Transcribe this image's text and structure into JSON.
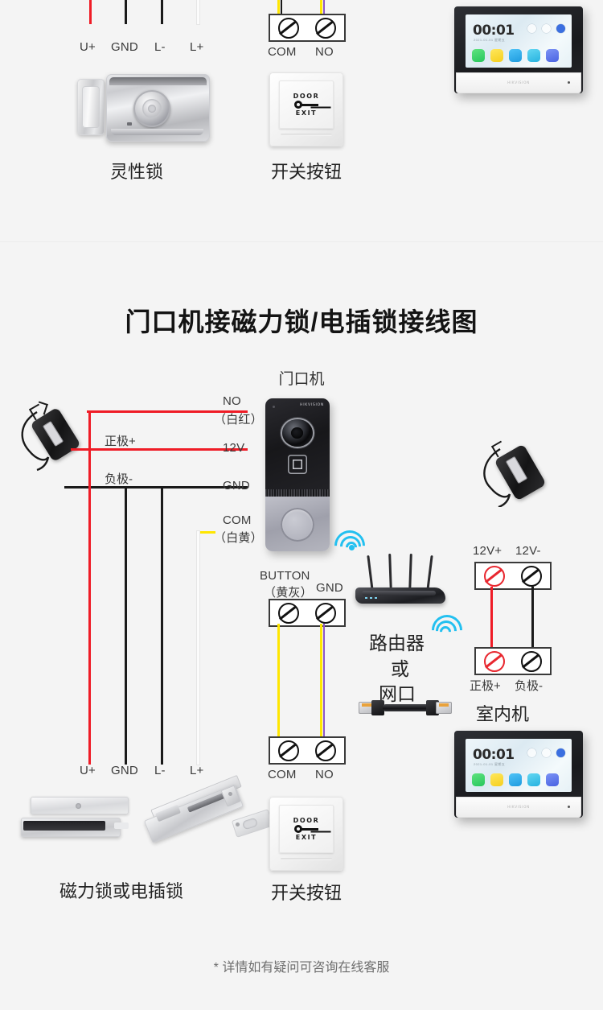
{
  "page": {
    "background": "#f4f4f4",
    "footer_note": "* 详情如有疑问可咨询在线客服"
  },
  "section_top": {
    "wire_labels": [
      "U+",
      "GND",
      "L-",
      "L+"
    ],
    "terminal_labels": [
      "COM",
      "NO"
    ],
    "lock_caption": "灵性锁",
    "button_caption": "开关按钮",
    "monitor": {
      "time": "00:01",
      "date": "2021-01-01 星期五",
      "brand": "HIKVISION"
    }
  },
  "section_main": {
    "title": "门口机接磁力锁/电插锁接线图",
    "door_station_caption": "门口机",
    "door_station_brand": "HIKVISION",
    "left_wire_labels": {
      "no": "NO",
      "no_color": "（白红）",
      "pos": "正极+",
      "v12": "12V",
      "neg": "负极-",
      "gnd": "GND",
      "com": "COM",
      "com_color": "（白黄）"
    },
    "button_terminal": {
      "left_label": "BUTTON",
      "left_color": "（黄灰）",
      "right_label": "GND"
    },
    "router_caption": [
      "路由器",
      "或",
      "网口"
    ],
    "indoor_power": {
      "top_terminal_labels": [
        "12V+",
        "12V-"
      ],
      "bottom_terminal_labels": [
        "正极+",
        "负极-"
      ],
      "caption": "室内机"
    },
    "bottom_wire_labels": [
      "U+",
      "GND",
      "L-",
      "L+"
    ],
    "bottom_terminal_labels": [
      "COM",
      "NO"
    ],
    "lock_caption": "磁力锁或电插锁",
    "button_caption": "开关按钮",
    "exit_button_text": {
      "top": "DOOR",
      "bottom": "EXIT",
      "icon": "key-icon"
    },
    "monitor": {
      "time": "00:01",
      "date": "2021-01-01 星期五",
      "brand": "HIKVISION"
    }
  },
  "colors": {
    "wire_red": "#ef1c26",
    "wire_black": "#1a1a1a",
    "wire_white": "#fbfbfb",
    "wire_yellow": "#ffe600",
    "wire_purple": "#8b57c9",
    "wifi_blue": "#23c0f0",
    "terminal_red": "#e8272f"
  }
}
